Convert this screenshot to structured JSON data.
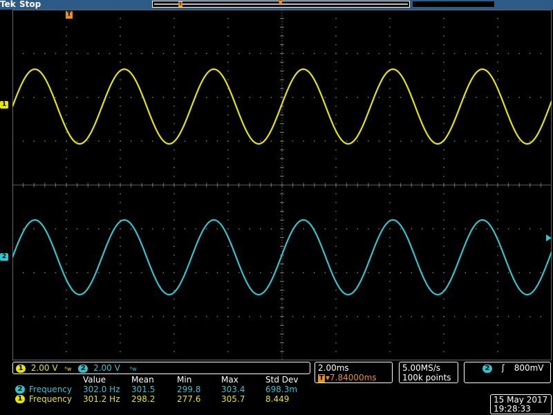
{
  "header": {
    "brand": "Tek",
    "status": "Stop"
  },
  "markers": {
    "trigger": "T",
    "ch1": "1",
    "ch2": "2"
  },
  "channels": {
    "ch1": {
      "num": "1",
      "scale": "2.00 V",
      "bw_symbol": "ᴮw",
      "color": "#e6e600"
    },
    "ch2": {
      "num": "2",
      "scale": "2.00 V",
      "bw_symbol": "ᴮw",
      "color": "#2fc5cf"
    }
  },
  "timebase": {
    "scale": "2.00ms",
    "trigger_delay": "▾7.84000ms",
    "sample_rate": "5.00MS/s",
    "record_length": "100k points"
  },
  "trigger": {
    "source": "2",
    "slope_symbol": "ʃ",
    "level": "800mV"
  },
  "measurements": {
    "headers": [
      "Value",
      "Mean",
      "Min",
      "Max",
      "Std Dev"
    ],
    "rows": [
      {
        "channel": "2",
        "name": "Frequency",
        "value": "302.0 Hz",
        "mean": "301.5",
        "min": "299.8",
        "max": "303.4",
        "std": "698.3m"
      },
      {
        "channel": "1",
        "name": "Frequency",
        "value": "301.2 Hz",
        "mean": "298.2",
        "min": "277.6",
        "max": "305.7",
        "std": "8.449"
      }
    ]
  },
  "datetime": {
    "date": "15 May 2017",
    "time": "19:28:33"
  }
}
